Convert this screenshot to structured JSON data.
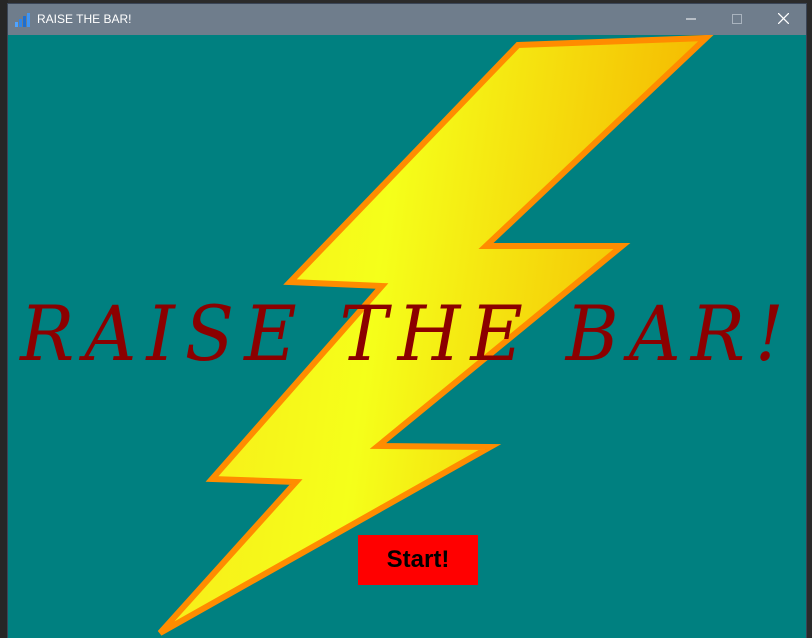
{
  "window": {
    "title": "RAISE THE BAR!",
    "app_icon": "bar-chart-icon",
    "controls": {
      "minimize_icon": "minimize-icon",
      "maximize_icon": "maximize-icon",
      "close_icon": "close-icon"
    }
  },
  "main": {
    "headline": "RAISE THE BAR!",
    "start_label": "Start!",
    "decoration": "lightning-bolt"
  },
  "colors": {
    "background": "#008080",
    "titlebar": "#6f7d8c",
    "headline": "#8b0000",
    "bolt_fill_light": "#f5ff1a",
    "bolt_fill_dark": "#f5b800",
    "bolt_outline": "#ff8c00",
    "start_button": "#ff0000"
  }
}
